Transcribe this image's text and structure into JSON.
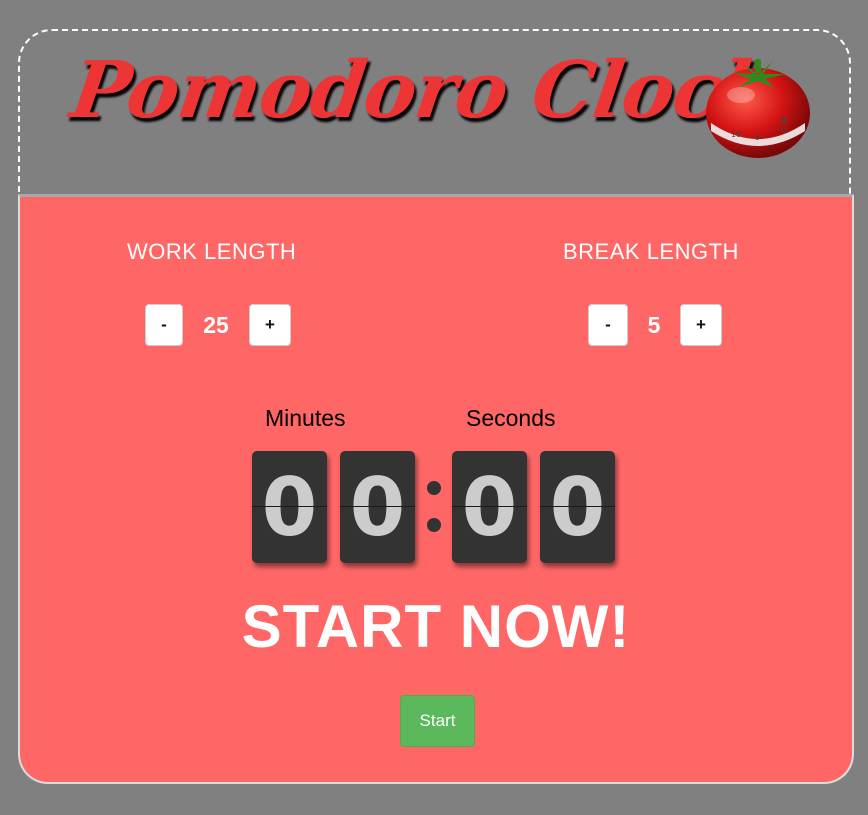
{
  "header": {
    "title": "Pomodoro Clock",
    "icon": "tomato-timer-icon"
  },
  "work": {
    "label": "WORK LENGTH",
    "decrement": "-",
    "value": "25",
    "increment": "+"
  },
  "break": {
    "label": "BREAK LENGTH",
    "decrement": "-",
    "value": "5",
    "increment": "+"
  },
  "clock": {
    "minutes_label": "Minutes",
    "seconds_label": "Seconds",
    "digits": [
      "0",
      "0",
      "0",
      "0"
    ]
  },
  "status": "START NOW!",
  "start_label": "Start",
  "colors": {
    "background": "#808080",
    "card": "#ff6666",
    "title": "#ee3535",
    "start_button": "#5cb85c",
    "flip_card": "#333333"
  }
}
